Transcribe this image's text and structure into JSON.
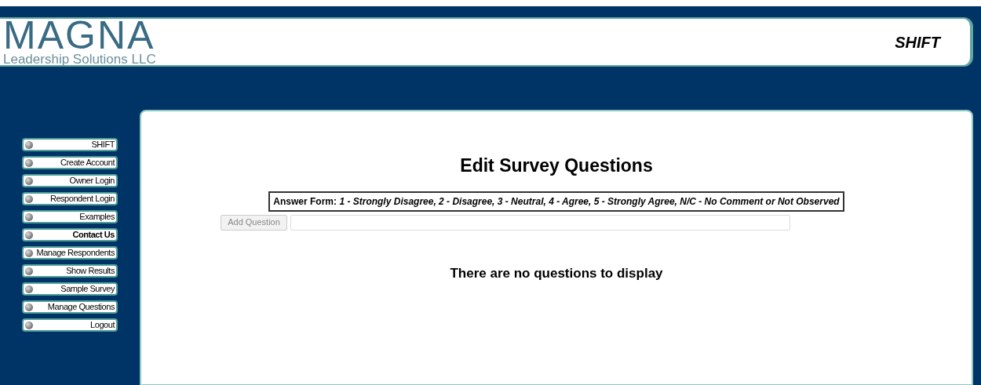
{
  "logo": {
    "name": "MAGNA",
    "tagline": "Leadership Solutions LLC"
  },
  "header": {
    "title": "SHIFT"
  },
  "sidebar": {
    "items": [
      {
        "label": "SHIFT",
        "bold": false
      },
      {
        "label": "Create Account",
        "bold": false
      },
      {
        "label": "Owner Login",
        "bold": false
      },
      {
        "label": "Respondent Login",
        "bold": false
      },
      {
        "label": "Examples",
        "bold": false
      },
      {
        "label": "Contact Us",
        "bold": true
      },
      {
        "label": "Manage Respondents",
        "bold": false
      },
      {
        "label": "Show Results",
        "bold": false
      },
      {
        "label": "Sample Survey",
        "bold": false
      },
      {
        "label": "Manage Questions",
        "bold": false
      },
      {
        "label": "Logout",
        "bold": false
      }
    ]
  },
  "main": {
    "title": "Edit Survey Questions",
    "answer_form": "Answer Form: *1 - Strongly Disagree, 2 - Disagree, 3 - Neutral, 4 - Agree, 5 - Strongly Agree, N/C - No Comment or Not Observed*",
    "add_button": {
      "label": "Add Question",
      "disabled": true
    },
    "empty_message": "There are no questions to display"
  }
}
